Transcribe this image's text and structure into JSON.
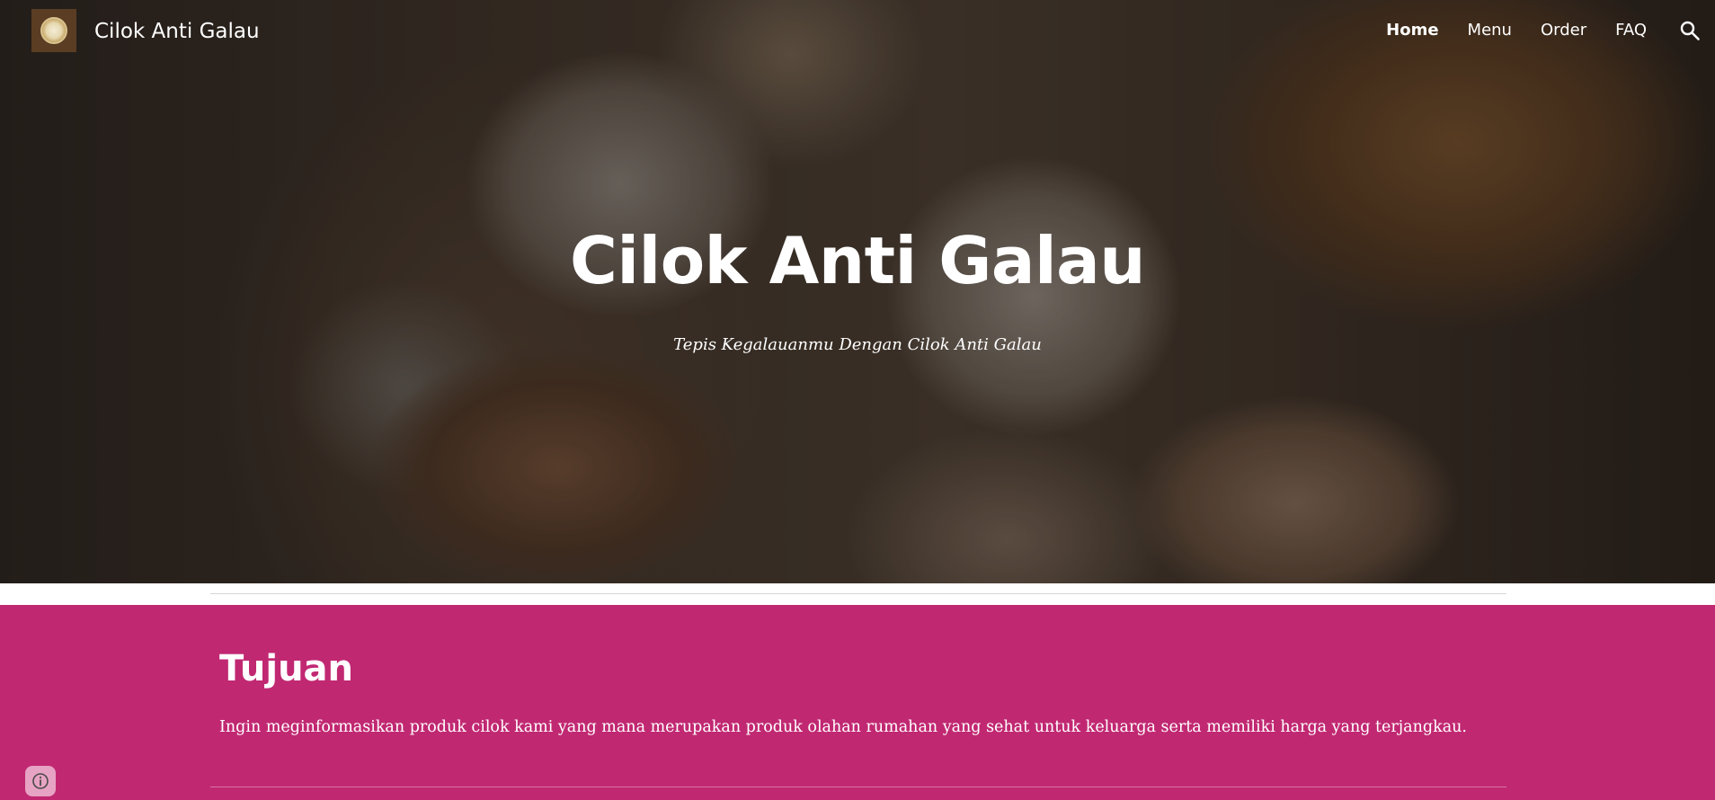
{
  "header": {
    "site_title": "Cilok Anti Galau",
    "nav": [
      {
        "label": "Home",
        "active": true
      },
      {
        "label": "Menu",
        "active": false
      },
      {
        "label": "Order",
        "active": false
      },
      {
        "label": "FAQ",
        "active": false
      }
    ],
    "search_icon": "search-icon"
  },
  "hero": {
    "title": "Cilok Anti Galau",
    "subtitle": "Tepis Kegalauanmu Dengan Cilok Anti Galau"
  },
  "section": {
    "title": "Tujuan",
    "text": "Ingin meginformasikan produk cilok kami yang mana merupakan produk olahan rumahan yang sehat untuk keluarga serta memiliki harga yang terjangkau."
  },
  "colors": {
    "section_bg": "#c12872",
    "text": "#ffffff"
  },
  "footer": {
    "info_icon": "info-icon"
  }
}
